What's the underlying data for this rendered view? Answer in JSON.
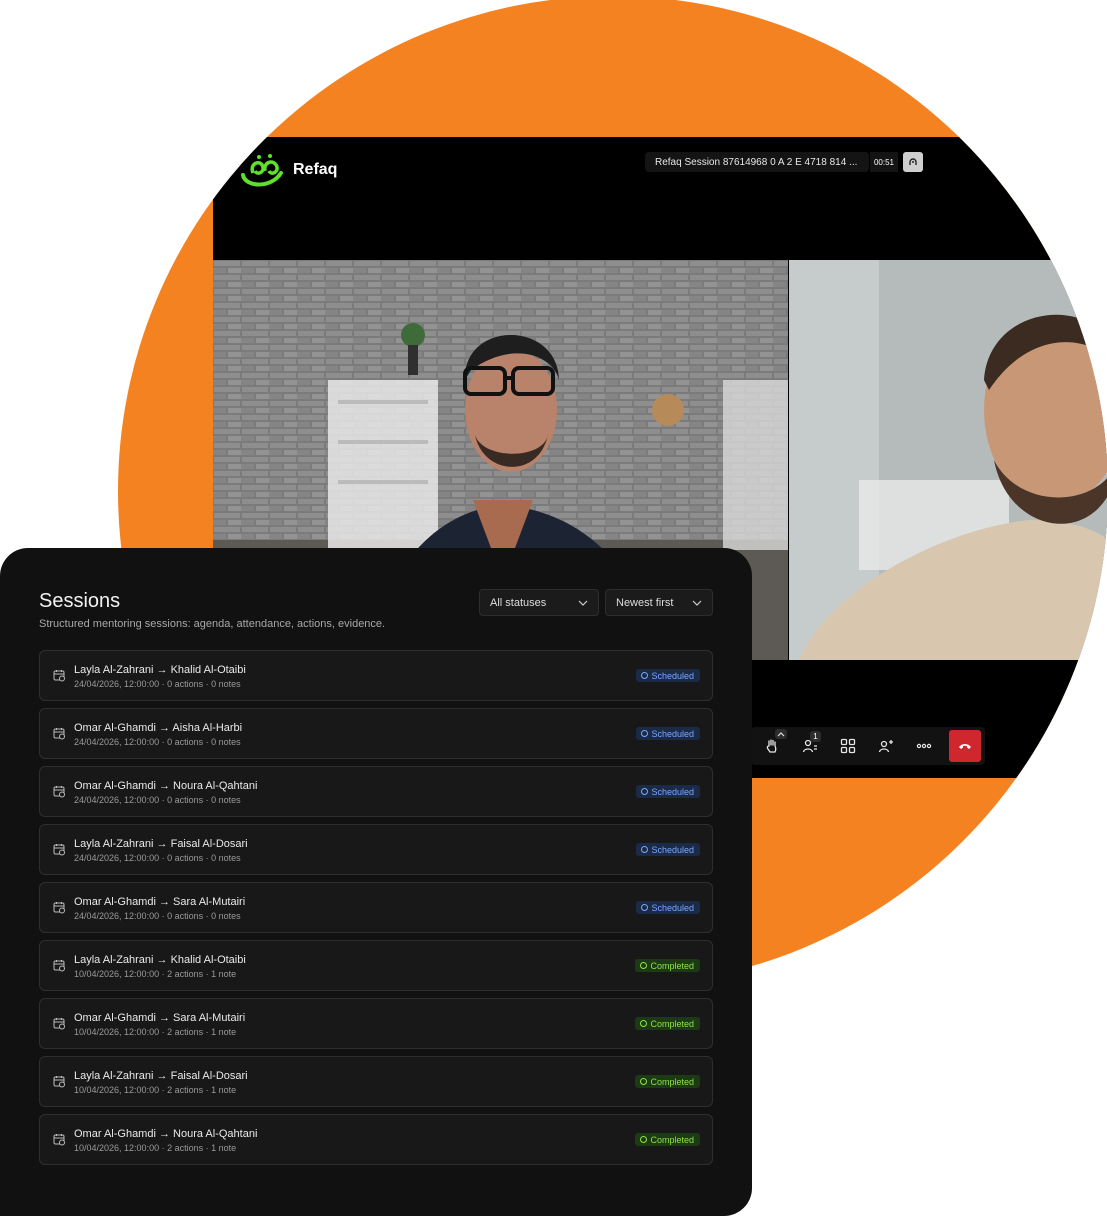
{
  "colors": {
    "accent_orange": "#f58220",
    "scheduled": "#7aa8ff",
    "completed": "#8fe34a",
    "end_call": "#d0262d"
  },
  "video_call": {
    "brand_name": "Refaq",
    "session_title": "Refaq Session 87614968 0 A 2 E 4718 814 ...",
    "timer": "00:51",
    "participants_badge": "1",
    "toolbar_icons": [
      "raise-hand-icon",
      "participants-icon",
      "grid-view-icon",
      "add-person-icon",
      "more-icon",
      "end-call-icon"
    ]
  },
  "sessions": {
    "title": "Sessions",
    "subtitle": "Structured mentoring sessions: agenda, attendance, actions, evidence.",
    "status_filter": "All statuses",
    "sort": "Newest first",
    "items": [
      {
        "title": "Layla Al-Zahrani → Khalid Al-Otaibi",
        "meta": "24/04/2026, 12:00:00 · 0 actions · 0 notes",
        "status": "Scheduled"
      },
      {
        "title": "Omar Al-Ghamdi → Aisha Al-Harbi",
        "meta": "24/04/2026, 12:00:00 · 0 actions · 0 notes",
        "status": "Scheduled"
      },
      {
        "title": "Omar Al-Ghamdi → Noura Al-Qahtani",
        "meta": "24/04/2026, 12:00:00 · 0 actions · 0 notes",
        "status": "Scheduled"
      },
      {
        "title": "Layla Al-Zahrani → Faisal Al-Dosari",
        "meta": "24/04/2026, 12:00:00 · 0 actions · 0 notes",
        "status": "Scheduled"
      },
      {
        "title": "Omar Al-Ghamdi → Sara Al-Mutairi",
        "meta": "24/04/2026, 12:00:00 · 0 actions · 0 notes",
        "status": "Scheduled"
      },
      {
        "title": "Layla Al-Zahrani → Khalid Al-Otaibi",
        "meta": "10/04/2026, 12:00:00 · 2 actions · 1 note",
        "status": "Completed"
      },
      {
        "title": "Omar Al-Ghamdi → Sara Al-Mutairi",
        "meta": "10/04/2026, 12:00:00 · 2 actions · 1 note",
        "status": "Completed"
      },
      {
        "title": "Layla Al-Zahrani → Faisal Al-Dosari",
        "meta": "10/04/2026, 12:00:00 · 2 actions · 1 note",
        "status": "Completed"
      },
      {
        "title": "Omar Al-Ghamdi → Noura Al-Qahtani",
        "meta": "10/04/2026, 12:00:00 · 2 actions · 1 note",
        "status": "Completed"
      }
    ]
  }
}
